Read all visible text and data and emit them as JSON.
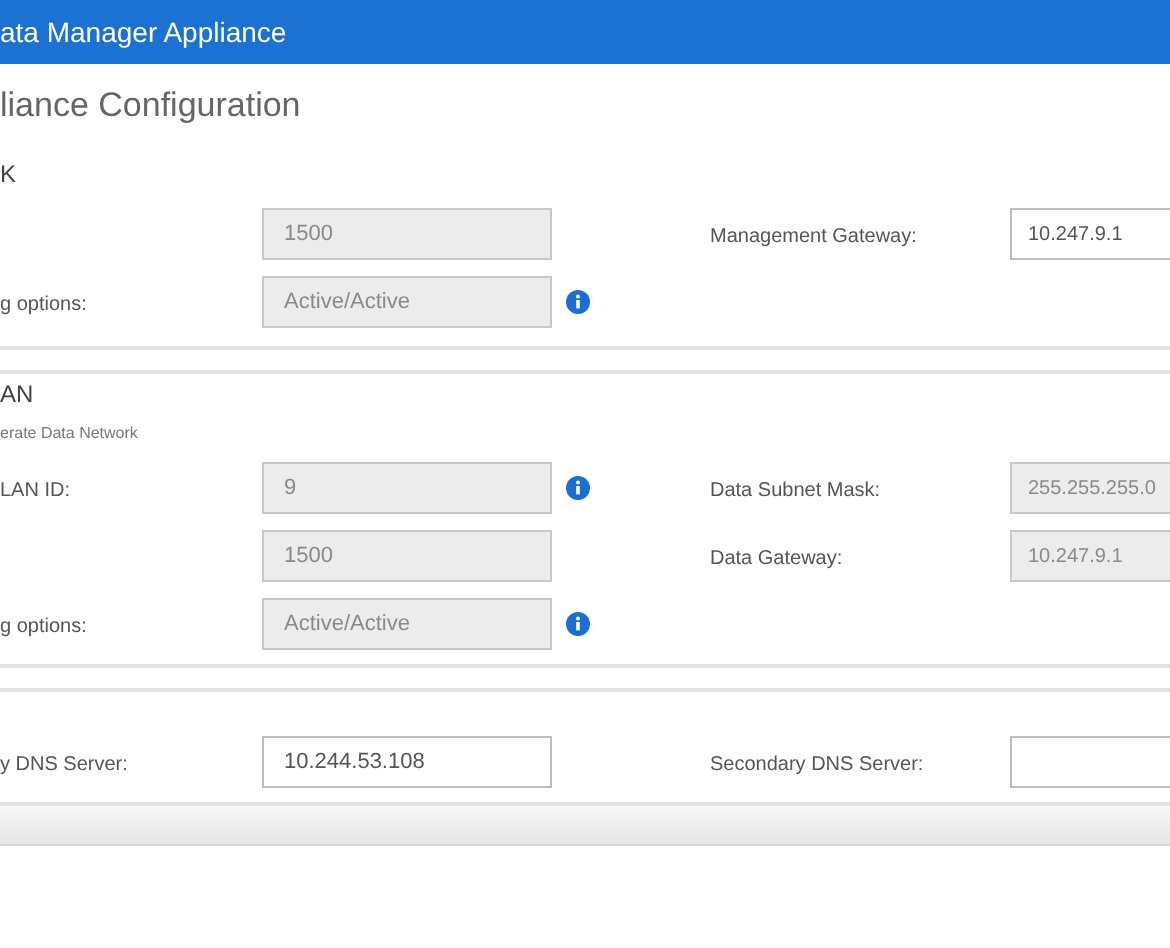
{
  "header": {
    "title": "ata Manager Appliance"
  },
  "page_title": "liance Configuration",
  "sections": [
    {
      "title": "K",
      "rows": [
        {
          "left": {
            "value": "1500",
            "disabled": true
          },
          "info": false,
          "right": {
            "label": "Management Gateway:",
            "value": "10.247.9.1",
            "disabled": false
          }
        },
        {
          "left": {
            "label": "g options:",
            "value": "Active/Active",
            "disabled": true
          },
          "info": true
        }
      ]
    },
    {
      "title": "AN",
      "subtitle": "erate Data Network",
      "rows": [
        {
          "left": {
            "label": "LAN ID:",
            "value": "9",
            "disabled": true
          },
          "info": true,
          "right": {
            "label": "Data Subnet Mask:",
            "value": "255.255.255.0",
            "disabled": true
          }
        },
        {
          "left": {
            "value": "1500",
            "disabled": true
          },
          "info": false,
          "right": {
            "label": "Data Gateway:",
            "value": "10.247.9.1",
            "disabled": true
          }
        },
        {
          "left": {
            "label": "g options:",
            "value": "Active/Active",
            "disabled": true
          },
          "info": true
        }
      ]
    },
    {
      "rows": [
        {
          "left": {
            "label": "y DNS Server:",
            "value": "10.244.53.108",
            "disabled": false
          },
          "info": false,
          "right": {
            "label": "Secondary DNS Server:",
            "disabled": false
          }
        }
      ]
    }
  ]
}
